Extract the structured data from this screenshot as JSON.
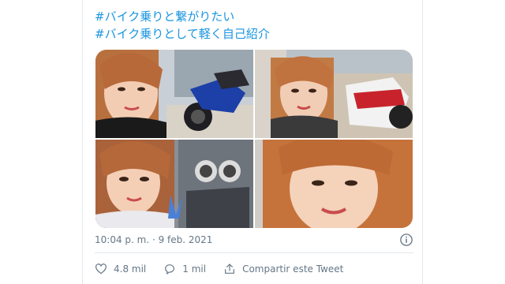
{
  "tweet": {
    "hashtags": [
      "#バイク乗りと繋がりたい",
      "#バイク乗りとして軽く自己紹介"
    ],
    "timestamp": "10:04 p. m. · 9 feb. 2021",
    "actions": {
      "likes": "4.8 mil",
      "replies": "1 mil",
      "share_label": "Compartir este Tweet"
    },
    "icons": {
      "info": "info-icon",
      "like": "heart-icon",
      "reply": "reply-bubble-icon",
      "share": "share-icon"
    }
  },
  "colors": {
    "link": "#1b95e0",
    "muted": "#657786",
    "border": "#e1e8ed"
  }
}
